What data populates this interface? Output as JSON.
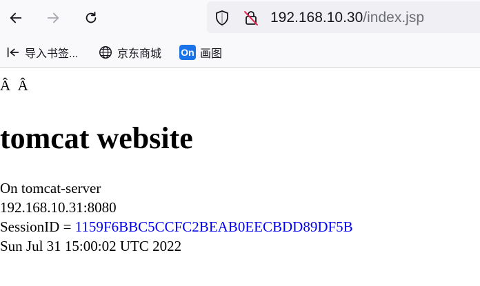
{
  "browser": {
    "url_host": "192.168.10.30",
    "url_path": "/index.jsp",
    "icons": [
      "back-arrow-icon",
      "forward-arrow-icon",
      "reload-icon",
      "shield-icon",
      "insecure-lock-icon"
    ]
  },
  "bookmarks": [
    {
      "label": "导入书签...",
      "icon": "import-icon"
    },
    {
      "label": "京东商城",
      "icon": "globe-icon"
    },
    {
      "label": "画图",
      "icon": "on-badge-icon",
      "badge_text": "On"
    }
  ],
  "page": {
    "garbled_text": "Â  Â",
    "heading": "tomcat website",
    "line_on": "On tomcat-server",
    "line_host": "192.168.10.31:8080",
    "session_label": "SessionID = ",
    "session_id": "1159F6BBC5CCFC2BEAB0EECBDD89DF5B",
    "date": "Sun Jul 31 15:00:02 UTC 2022"
  },
  "colors": {
    "link": "#0000ee",
    "url_path": "#6d6d76",
    "on_badge": "#1a73e8"
  }
}
